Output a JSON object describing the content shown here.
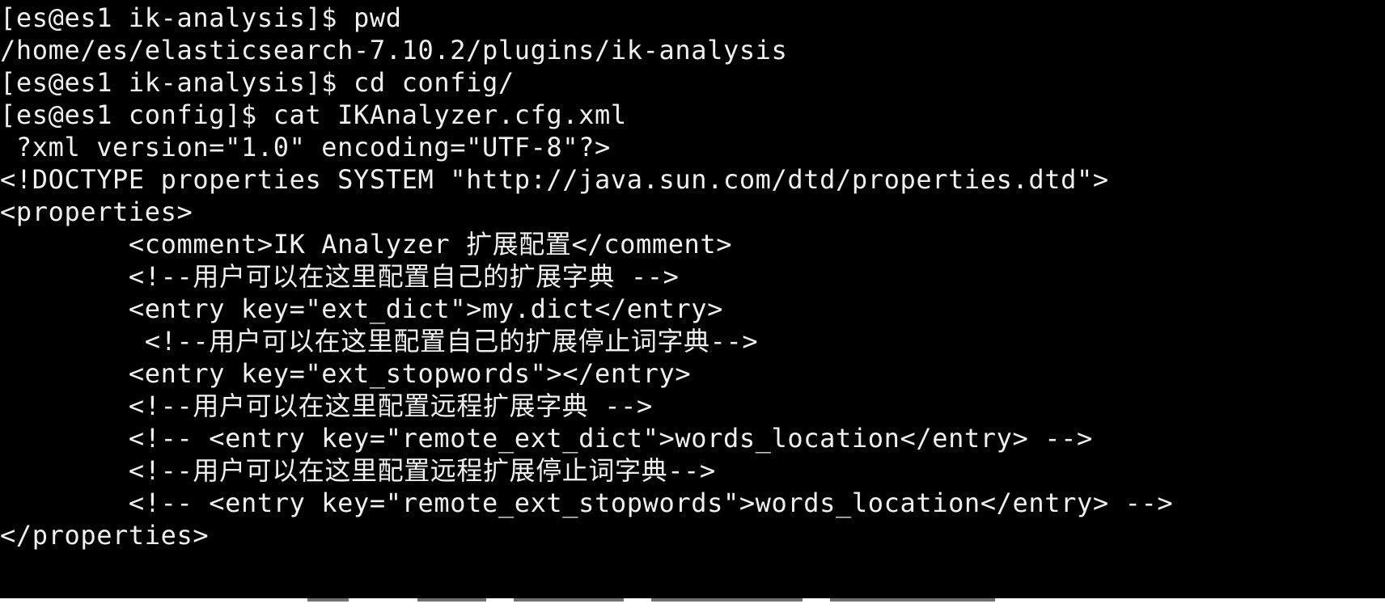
{
  "terminal": {
    "lines": [
      "[es@es1 ik-analysis]$ pwd",
      "/home/es/elasticsearch-7.10.2/plugins/ik-analysis",
      "[es@es1 ik-analysis]$ cd config/",
      "[es@es1 config]$ cat IKAnalyzer.cfg.xml",
      " ?xml version=\"1.0\" encoding=\"UTF-8\"?>",
      "<!DOCTYPE properties SYSTEM \"http://java.sun.com/dtd/properties.dtd\">",
      "<properties>",
      "        <comment>IK Analyzer 扩展配置</comment>",
      "        <!--用户可以在这里配置自己的扩展字典 -->",
      "        <entry key=\"ext_dict\">my.dict</entry>",
      "         <!--用户可以在这里配置自己的扩展停止词字典-->",
      "        <entry key=\"ext_stopwords\"></entry>",
      "        <!--用户可以在这里配置远程扩展字典 -->",
      "        <!-- <entry key=\"remote_ext_dict\">words_location</entry> -->",
      "        <!--用户可以在这里配置远程扩展停止词字典-->",
      "        <!-- <entry key=\"remote_ext_stopwords\">words_location</entry> -->",
      "</properties>"
    ]
  },
  "colors": {
    "background": "#000000",
    "foreground": "#f0f0f0"
  }
}
